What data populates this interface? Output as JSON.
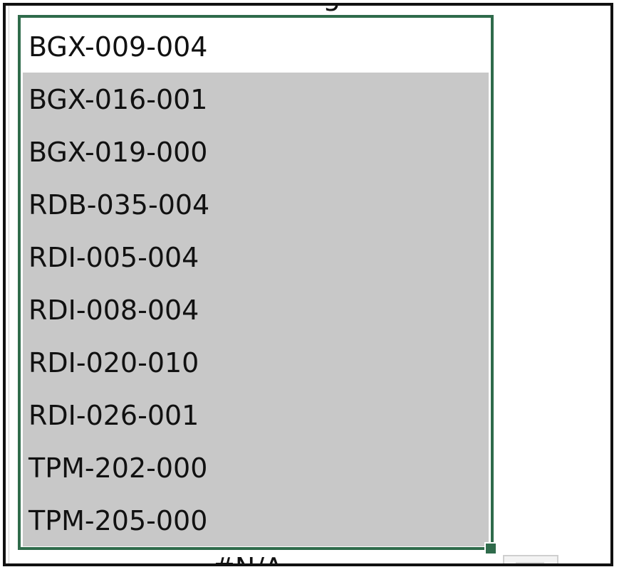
{
  "column_header_fragment": "g",
  "cells": [
    "BGX-009-004",
    "BGX-016-001",
    "BGX-019-000",
    "RDB-035-004",
    "RDI-005-004",
    "RDI-008-004",
    "RDI-020-010",
    "RDI-026-001",
    "TPM-202-000",
    "TPM-205-000"
  ],
  "below_cell_value": "#N/A",
  "colors": {
    "selection_border": "#2f6b4b",
    "selected_fill": "#c8c8c8",
    "active_cell_fill": "#ffffff"
  },
  "icons": {
    "quick_analysis": "quick-analysis-icon"
  }
}
